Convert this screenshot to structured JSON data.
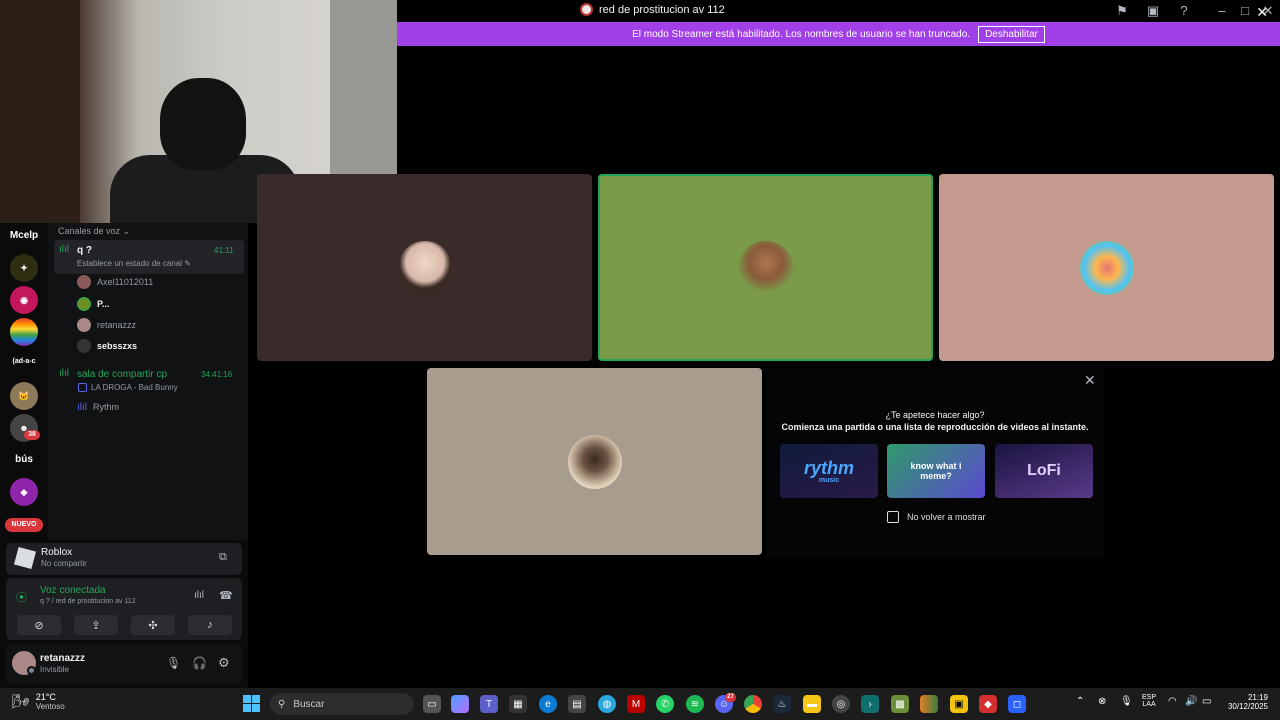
{
  "window": {
    "title": "red de prostitucion av 112"
  },
  "banner": {
    "text": "El modo Streamer está habilitado. Los nombres de usuario se han truncado.",
    "button": "Deshabilitar"
  },
  "rail": {
    "items": [
      {
        "label": "Mcelp",
        "type": "text"
      },
      {
        "label": "",
        "type": "icon",
        "color": "#2d2d12"
      },
      {
        "label": "",
        "type": "icon",
        "color": "#c2185b"
      },
      {
        "label": "",
        "type": "icon",
        "color": "#e53935"
      },
      {
        "label": "(ad-a-c",
        "type": "text"
      },
      {
        "label": "",
        "type": "icon",
        "color": "#8d7a5a"
      },
      {
        "label": "",
        "type": "icon",
        "color": "#444"
      },
      {
        "label": "bús",
        "type": "text"
      },
      {
        "label": "",
        "type": "icon",
        "color": "#8e24aa"
      }
    ],
    "badge": "38",
    "new_label": "NUEVO"
  },
  "channels": {
    "category": "Canales de voz",
    "voice1": {
      "name": "q ?",
      "time": "41:11",
      "status": "Establece un estado de canal"
    },
    "members1": [
      {
        "name": "Axel11012011",
        "bright": false,
        "color": "#8a5a5a"
      },
      {
        "name": "P...",
        "bright": true,
        "color": "#6b8e23"
      },
      {
        "name": "retanazzz",
        "bright": false,
        "color": "#a88"
      },
      {
        "name": "sebsszxs",
        "bright": true,
        "color": "#333"
      }
    ],
    "voice2": {
      "name": "sala de compartir cp",
      "time": "34:41:16",
      "activity": "LA DROGA - Bad Bunny"
    },
    "members2": [
      {
        "name": "Rythm"
      }
    ]
  },
  "activity_status": {
    "game": "Roblox",
    "sub": "No compartir"
  },
  "voice_panel": {
    "status": "Voz conectada",
    "channel": "q ? / red de prostitucion av 112"
  },
  "user": {
    "name": "retanazzz",
    "status": "Invisible"
  },
  "tiles": {
    "colors": [
      "#3a2b2b",
      "#7a9a4a",
      "#c49a8e",
      "#a79c8e"
    ]
  },
  "activity_panel": {
    "title": "¿Te apetece hacer algo?",
    "subtitle": "Comienza una partida o una lista de reproducción de videos al instante.",
    "cards": [
      {
        "label": "rythm",
        "sub": "music",
        "color": "#1a2340"
      },
      {
        "label": "know what i meme?",
        "sub": "",
        "color": "#4a3fb0"
      },
      {
        "label": "LoFi",
        "sub": "",
        "color": "#3a2f6a"
      }
    ],
    "checkbox_label": "No volver a mostrar"
  },
  "taskbar": {
    "weather_temp": "21°C",
    "weather_desc": "Ventoso",
    "search_placeholder": "Buscar",
    "lang_line1": "ESP",
    "lang_line2": "LAA",
    "time": "21:19",
    "date": "30/12/2025",
    "discord_badge": "27"
  }
}
